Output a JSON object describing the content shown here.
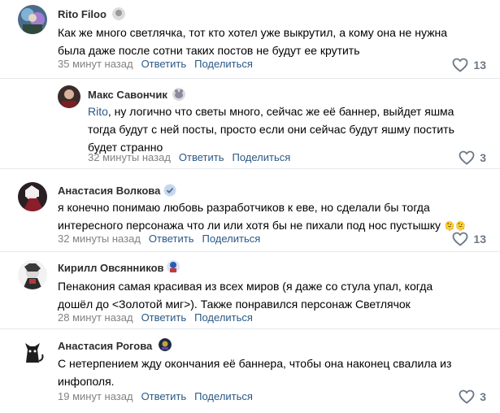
{
  "comments": [
    {
      "author": "Rito Filoo",
      "text": "Как же много светлячка, тот кто хотел уже выкрутил, а кому она не нужна была даже после сотни таких постов не будут ее крутить",
      "time": "35 минут назад",
      "reply_label": "Ответить",
      "share_label": "Поделиться",
      "likes": "13"
    },
    {
      "author": "Макс Савончик",
      "mention": "Rito",
      "text": ", ну логично что светы много, сейчас же её баннер, выйдет яшма тогда будут с ней посты, просто если они сейчас будут яшму постить будет странно",
      "time": "32 минуты назад",
      "reply_label": "Ответить",
      "share_label": "Поделиться",
      "likes": "3"
    },
    {
      "author": "Анастасия Волкова",
      "text": "я конечно понимаю любовь разработчиков к еве, но сделали бы тогда интересного персонажа что ли или хотя бы не пихали под нос пустышку",
      "text_emoji": "🫠🫠",
      "time": "32 минуты назад",
      "reply_label": "Ответить",
      "share_label": "Поделиться",
      "likes": "13"
    },
    {
      "author": "Кирилл Овсянников",
      "text": "Пенакония самая красивая из всех миров (я даже со стула упал, когда дошёл до <Золотой миг>). Также понравился персонаж Светлячок",
      "time": "28 минут назад",
      "reply_label": "Ответить",
      "share_label": "Поделиться",
      "likes": ""
    },
    {
      "author": "Анастасия Рогова",
      "text": "С нетерпением жду окончания её баннера, чтобы она наконец свалила из инфополя.",
      "time": "19 минут назад",
      "reply_label": "Ответить",
      "share_label": "Поделиться",
      "likes": "3"
    }
  ],
  "colors": {
    "link": "#2a5885",
    "muted": "#828282",
    "like_icon": "#6d7885",
    "divider": "#e7e8ec"
  },
  "icons": {
    "like": "heart-outline-icon"
  }
}
